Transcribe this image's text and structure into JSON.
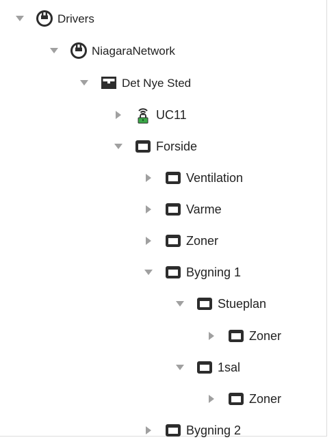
{
  "tree": {
    "drivers": {
      "label": "Drivers",
      "icon": "drivers-icon",
      "expanded": true
    },
    "niagara_network": {
      "label": "NiagaraNetwork",
      "icon": "network-icon",
      "expanded": true
    },
    "det_nye_sted": {
      "label": "Det Nye Sted",
      "icon": "station-icon",
      "expanded": true
    },
    "uc11": {
      "label": "UC11",
      "icon": "device-icon",
      "expanded": false
    },
    "forside": {
      "label": "Forside",
      "icon": "folder-icon",
      "expanded": true
    },
    "ventilation": {
      "label": "Ventilation",
      "icon": "folder-icon",
      "expanded": false
    },
    "varme": {
      "label": "Varme",
      "icon": "folder-icon",
      "expanded": false
    },
    "zoner_top": {
      "label": "Zoner",
      "icon": "folder-icon",
      "expanded": false
    },
    "bygning1": {
      "label": "Bygning 1",
      "icon": "folder-icon",
      "expanded": true
    },
    "stueplan": {
      "label": "Stueplan",
      "icon": "folder-icon",
      "expanded": true
    },
    "stueplan_zoner": {
      "label": "Zoner",
      "icon": "folder-icon",
      "expanded": false
    },
    "first_floor": {
      "label": "1sal",
      "icon": "folder-icon",
      "expanded": true
    },
    "first_floor_zoner": {
      "label": "Zoner",
      "icon": "folder-icon",
      "expanded": false
    },
    "bygning2": {
      "label": "Bygning 2",
      "icon": "folder-icon",
      "expanded": false
    }
  },
  "colors": {
    "toggle": "#a0a0a0",
    "icon_dark": "#2d2d2d",
    "lock_green": "#3aa847",
    "text": "#222222"
  }
}
